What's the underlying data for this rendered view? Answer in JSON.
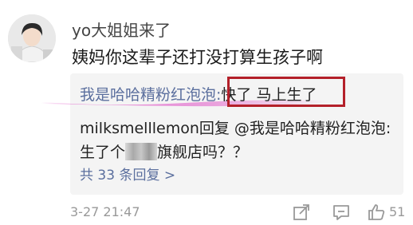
{
  "comment": {
    "username": "yo大姐姐来了",
    "text": "姨妈你这辈子还打没打算生孩子啊"
  },
  "replies": [
    {
      "user": "我是哈哈精粉红泡泡:",
      "body": "快了  马上生了"
    },
    {
      "prefix": "milksmelllemon回复 @我是哈哈精粉红泡泡:生了个",
      "suffix": "旗舰店吗？？"
    }
  ],
  "more_replies": "共 33 条回复 >",
  "timestamp": "3-27 21:47",
  "actions": {
    "share_icon": "share-icon",
    "comment_icon": "comment-icon",
    "like_icon": "thumbs-up-icon",
    "like_count": "51"
  }
}
